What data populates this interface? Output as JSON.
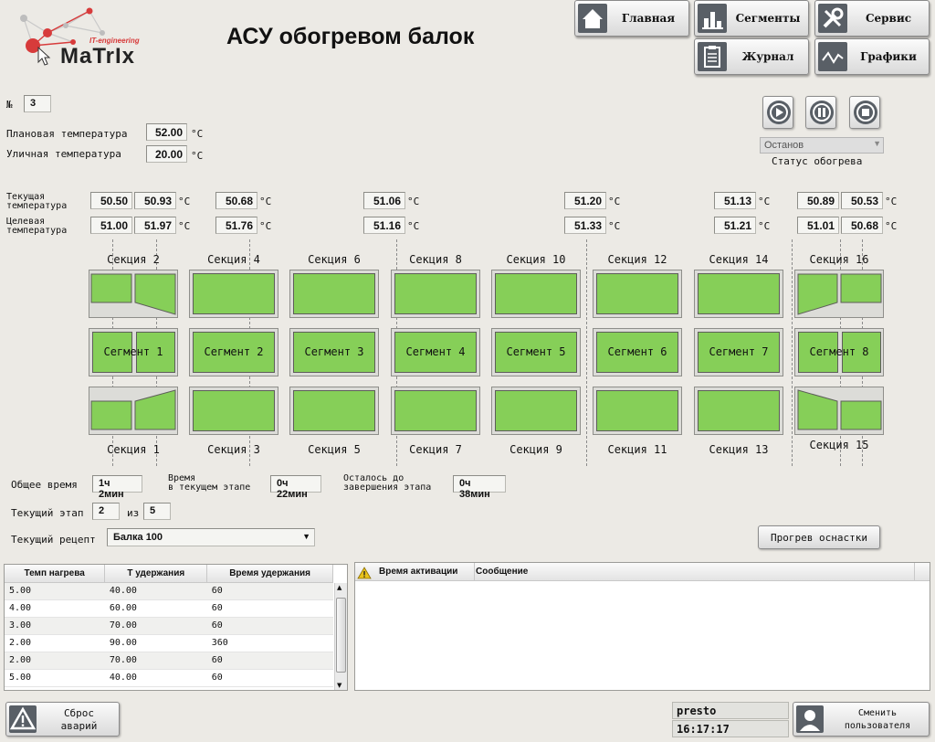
{
  "header": {
    "brand_tagline": "IT-engineering",
    "brand_name": "MaTrIx",
    "title": "АСУ обогревом балок",
    "nav": {
      "home": "Главная",
      "segments": "Сегменты",
      "service": "Сервис",
      "journal": "Журнал",
      "charts": "Графики"
    }
  },
  "info": {
    "number_label": "№",
    "number_value": "3",
    "plan_temp_label": "Плановая температура",
    "plan_temp_value": "52.00",
    "outdoor_temp_label": "Уличная температура",
    "outdoor_temp_value": "20.00",
    "unit": "°C"
  },
  "control": {
    "status_value": "Останов",
    "status_label": "Статус обогрева"
  },
  "temps": {
    "current_label_1": "Текущая",
    "current_label_2": "температура",
    "target_label_1": "Целевая",
    "target_label_2": "температура",
    "current": [
      "50.50",
      "50.93",
      "50.68",
      "51.06",
      "51.20",
      "51.13",
      "50.89",
      "50.53"
    ],
    "target": [
      "51.00",
      "51.97",
      "51.76",
      "51.16",
      "51.33",
      "51.21",
      "51.01",
      "50.68"
    ]
  },
  "segments": [
    "Сегмент 1",
    "Сегмент 2",
    "Сегмент 3",
    "Сегмент 4",
    "Сегмент 5",
    "Сегмент 6",
    "Сегмент 7",
    "Сегмент 8"
  ],
  "sections_top": [
    "Секция 2",
    "Секция 4",
    "Секция 6",
    "Секция 8",
    "Секция 10",
    "Секция 12",
    "Секция 14",
    "Секция 16"
  ],
  "sections_bottom": [
    "Секция 1",
    "Секция 3",
    "Секция 5",
    "Секция 7",
    "Секция 9",
    "Секция 11",
    "Секция 13",
    "Секция 15"
  ],
  "timing": {
    "total_label": "Общее время",
    "total_value": "1ч 2мин",
    "stage_time_label_1": "Время",
    "stage_time_label_2": "в текущем этапе",
    "stage_time_value": "0ч 22мин",
    "remaining_label_1": "Осталось до",
    "remaining_label_2": "завершения этапа",
    "remaining_value": "0ч 38мин",
    "stage_label": "Текущий этап",
    "stage_value": "2",
    "of_label": "из",
    "stage_total": "5",
    "recipe_label": "Текущий рецепт",
    "recipe_value": "Балка 100",
    "warmup_button": "Прогрев оснастки"
  },
  "recipe_table": {
    "headers": [
      "Темп нагрева",
      "Т удержания",
      "Время удержания"
    ],
    "rows": [
      [
        "5.00",
        "40.00",
        "60"
      ],
      [
        "4.00",
        "60.00",
        "60"
      ],
      [
        "3.00",
        "70.00",
        "60"
      ],
      [
        "2.00",
        "90.00",
        "360"
      ],
      [
        "2.00",
        "70.00",
        "60"
      ],
      [
        "5.00",
        "40.00",
        "60"
      ]
    ]
  },
  "alarm_table": {
    "headers": [
      "Время активации",
      "Сообщение"
    ]
  },
  "footer": {
    "reset_label_1": "Сброс",
    "reset_label_2": "аварий",
    "user": "presto",
    "clock": "16:17:17",
    "change_user_1": "Сменить",
    "change_user_2": "пользователя"
  },
  "colors": {
    "segment_fill": "#86cf58",
    "background": "#eceae5",
    "icon_bg": "#595f66",
    "alarm_icon": "#e8c21a"
  }
}
